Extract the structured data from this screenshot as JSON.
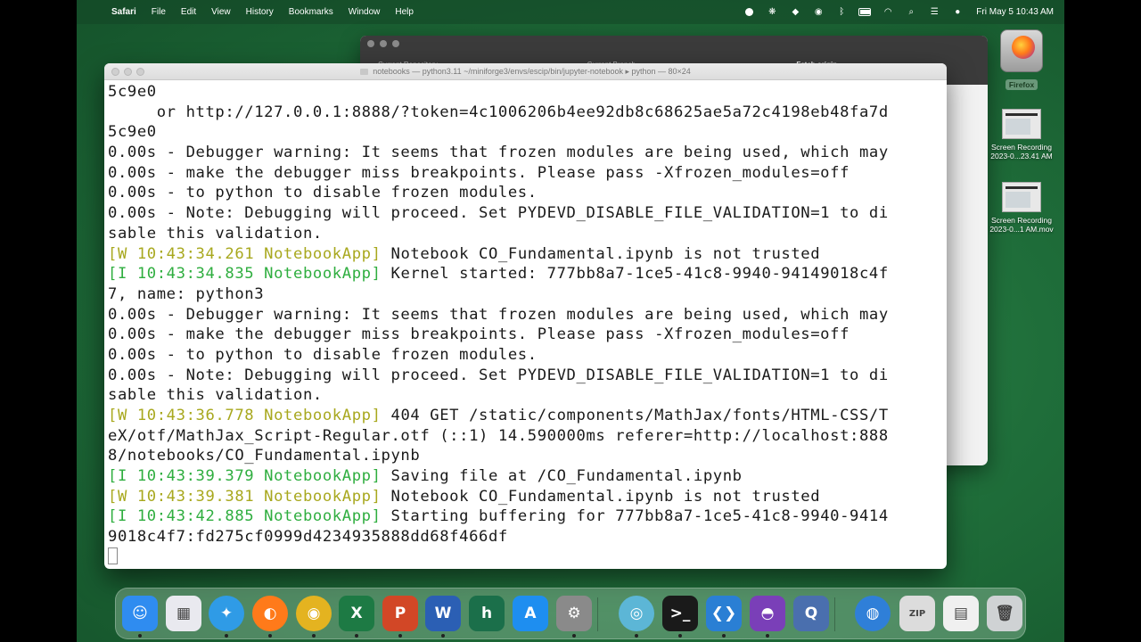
{
  "menubar": {
    "app_name": "Safari",
    "items": [
      "File",
      "Edit",
      "View",
      "History",
      "Bookmarks",
      "Window",
      "Help"
    ],
    "clock": "Fri May 5  10:43 AM"
  },
  "background_window": {
    "tabs": [
      "Current Repository",
      "Current Branch",
      "Fetch origin"
    ]
  },
  "terminal": {
    "title": "notebooks — python3.11 ~/miniforge3/envs/escip/bin/jupyter-notebook ▸ python — 80×24",
    "lines": [
      [
        {
          "t": "5c9e0"
        }
      ],
      [
        {
          "t": "     or http://127.0.0.1:8888/?token=4c1006206b4ee92db8c68625ae5a72c4198eb48fa7d"
        }
      ],
      [
        {
          "t": "5c9e0"
        }
      ],
      [
        {
          "t": "0.00s - Debugger warning: It seems that frozen modules are being used, which may"
        }
      ],
      [
        {
          "t": "0.00s - make the debugger miss breakpoints. Please pass -Xfrozen_modules=off"
        }
      ],
      [
        {
          "t": "0.00s - to python to disable frozen modules."
        }
      ],
      [
        {
          "t": "0.00s - Note: Debugging will proceed. Set PYDEVD_DISABLE_FILE_VALIDATION=1 to di"
        }
      ],
      [
        {
          "t": "sable this validation."
        }
      ],
      [
        {
          "t": "[W 10:43:34.261 NotebookApp]",
          "c": "w"
        },
        {
          "t": " Notebook CO_Fundamental.ipynb is not trusted"
        }
      ],
      [
        {
          "t": "[I 10:43:34.835 NotebookApp]",
          "c": "i"
        },
        {
          "t": " Kernel started: 777bb8a7-1ce5-41c8-9940-94149018c4f"
        }
      ],
      [
        {
          "t": "7, name: python3"
        }
      ],
      [
        {
          "t": "0.00s - Debugger warning: It seems that frozen modules are being used, which may"
        }
      ],
      [
        {
          "t": "0.00s - make the debugger miss breakpoints. Please pass -Xfrozen_modules=off"
        }
      ],
      [
        {
          "t": "0.00s - to python to disable frozen modules."
        }
      ],
      [
        {
          "t": "0.00s - Note: Debugging will proceed. Set PYDEVD_DISABLE_FILE_VALIDATION=1 to di"
        }
      ],
      [
        {
          "t": "sable this validation."
        }
      ],
      [
        {
          "t": "[W 10:43:36.778 NotebookApp]",
          "c": "w"
        },
        {
          "t": " 404 GET /static/components/MathJax/fonts/HTML-CSS/T"
        }
      ],
      [
        {
          "t": "eX/otf/MathJax_Script-Regular.otf (::1) 14.590000ms referer=http://localhost:888"
        }
      ],
      [
        {
          "t": "8/notebooks/CO_Fundamental.ipynb"
        }
      ],
      [
        {
          "t": "[I 10:43:39.379 NotebookApp]",
          "c": "i"
        },
        {
          "t": " Saving file at /CO_Fundamental.ipynb"
        }
      ],
      [
        {
          "t": "[W 10:43:39.381 NotebookApp]",
          "c": "w"
        },
        {
          "t": " Notebook CO_Fundamental.ipynb is not trusted"
        }
      ],
      [
        {
          "t": "[I 10:43:42.885 NotebookApp]",
          "c": "i"
        },
        {
          "t": " Starting buffering for 777bb8a7-1ce5-41c8-9940-9414"
        }
      ],
      [
        {
          "t": "9018c4f7:fd275cf0999d4234935888dd68f466df"
        }
      ]
    ]
  },
  "desktop": {
    "firefox_label": "Firefox",
    "recording1_label": "Screen Recording 2023-0...23.41 AM",
    "recording2_label": "Screen Recording 2023-0...1 AM.mov"
  },
  "dock": {
    "apps": [
      {
        "name": "finder",
        "glyph": "☺",
        "bg": "#2f8cf0"
      },
      {
        "name": "launchpad",
        "glyph": "▦",
        "bg": "#e9e9ef"
      },
      {
        "name": "safari",
        "glyph": "✦",
        "bg": "#2f9be6"
      },
      {
        "name": "firefox",
        "glyph": "◐",
        "bg": "#ff7a1a"
      },
      {
        "name": "chrome",
        "glyph": "◉",
        "bg": "#e4b320"
      },
      {
        "name": "excel",
        "glyph": "X",
        "bg": "#1d7a44"
      },
      {
        "name": "powerpoint",
        "glyph": "P",
        "bg": "#d24726"
      },
      {
        "name": "word",
        "glyph": "W",
        "bg": "#2b5fb4"
      },
      {
        "name": "app-h",
        "glyph": "h",
        "bg": "#1b6f4a"
      },
      {
        "name": "app-store",
        "glyph": "A",
        "bg": "#1e8ef0"
      },
      {
        "name": "system-settings",
        "glyph": "⚙",
        "bg": "#8a8a8a"
      },
      {
        "name": "network-utility",
        "glyph": "◎",
        "bg": "#5cb6d6"
      },
      {
        "name": "terminal",
        "glyph": ">_",
        "bg": "#1a1a1a"
      },
      {
        "name": "vscode",
        "glyph": "❮❯",
        "bg": "#2a7fd4"
      },
      {
        "name": "github-desktop",
        "glyph": "◓",
        "bg": "#7a3fb8"
      },
      {
        "name": "quicktime",
        "glyph": "Q",
        "bg": "#4a6fae"
      },
      {
        "name": "downloads-globe",
        "glyph": "◍",
        "bg": "#2f7fd8"
      },
      {
        "name": "archive",
        "glyph": "ZIP",
        "bg": "#dcdcdc"
      },
      {
        "name": "document-stack",
        "glyph": "▤",
        "bg": "#f0f0f0"
      },
      {
        "name": "trash",
        "glyph": "🗑",
        "bg": "#cfd2d4"
      }
    ]
  }
}
